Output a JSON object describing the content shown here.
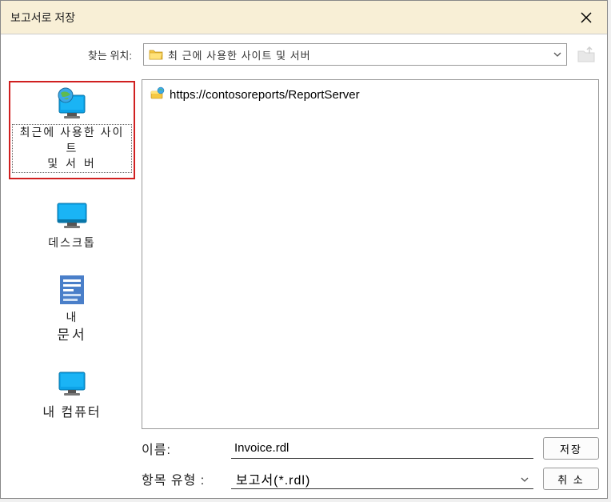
{
  "titlebar": {
    "title": "보고서로 저장"
  },
  "toolbar": {
    "location_label": "찾는 위치:",
    "location_value": "최 근에 사용한 사이트 및 서버"
  },
  "sidebar": {
    "items": [
      {
        "label_line1": "최근에 사용한 사이트",
        "label_line2": "및  서 버"
      },
      {
        "label": "데스크톱"
      },
      {
        "label_line1": "내",
        "label_line2": "문서"
      },
      {
        "label": "내 컴퓨터"
      }
    ]
  },
  "file_list": {
    "items": [
      {
        "name": "https://contosoreports/ReportServer"
      }
    ]
  },
  "form": {
    "name_label": "이름:",
    "name_value": "Invoice.rdl",
    "type_label": "항목 유형 :",
    "type_value": "보고서(*.rdl)"
  },
  "buttons": {
    "save": "저장",
    "cancel": "취 소"
  }
}
